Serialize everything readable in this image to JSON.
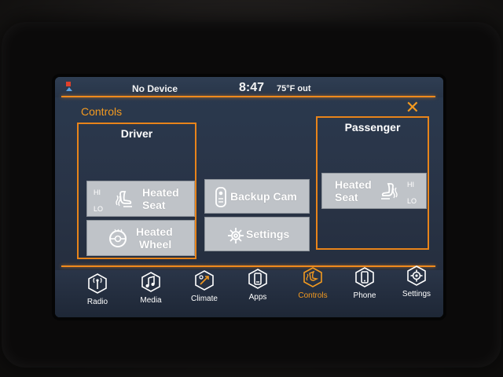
{
  "status": {
    "device": "No Device",
    "time": "8:47",
    "temp": "75°F out"
  },
  "header": {
    "title": "Controls",
    "close_icon": "close-x-icon"
  },
  "driver": {
    "title": "Driver",
    "heated_seat": {
      "hi": "HI",
      "lo": "LO",
      "line1": "Heated",
      "line2": "Seat"
    },
    "heated_wheel": {
      "line1": "Heated",
      "line2": "Wheel"
    }
  },
  "center": {
    "backup_cam": "Backup Cam",
    "settings": "Settings"
  },
  "passenger": {
    "title": "Passenger",
    "heated_seat": {
      "hi": "HI",
      "lo": "LO",
      "line1": "Heated",
      "line2": "Seat"
    }
  },
  "nav": [
    {
      "label": "Radio",
      "icon": "radio-icon"
    },
    {
      "label": "Media",
      "icon": "media-icon"
    },
    {
      "label": "Climate",
      "icon": "climate-icon"
    },
    {
      "label": "Apps",
      "icon": "apps-icon"
    },
    {
      "label": "Controls",
      "icon": "controls-icon",
      "active": true
    },
    {
      "label": "Phone",
      "icon": "phone-icon"
    },
    {
      "label": "Settings",
      "icon": "settings-icon"
    }
  ],
  "colors": {
    "accent": "#f39a20",
    "button": "#bfc3c8",
    "screen_bg": "#2b3a4f"
  }
}
